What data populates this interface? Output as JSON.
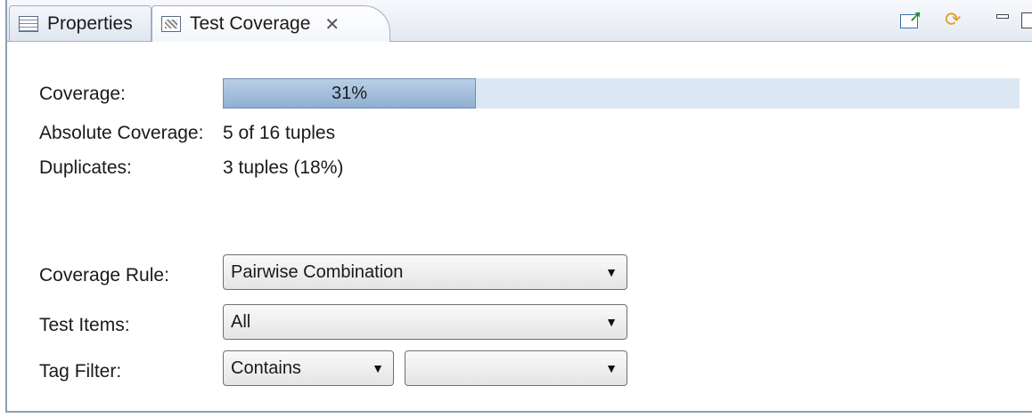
{
  "tabs": [
    {
      "label": "Properties",
      "icon": "properties-icon"
    },
    {
      "label": "Test Coverage",
      "icon": "coverage-icon",
      "active": true
    }
  ],
  "toolbar": {
    "export_icon": "export-icon",
    "refresh_icon": "refresh-icon",
    "minimize_icon": "minimize-icon",
    "maximize_icon": "maximize-icon"
  },
  "coverage": {
    "label": "Coverage:",
    "percent_text": "31%",
    "fraction": 0.31
  },
  "absolute": {
    "label": "Absolute Coverage:",
    "value": "5 of 16 tuples"
  },
  "duplicates": {
    "label": "Duplicates:",
    "value": "3 tuples (18%)"
  },
  "coverage_rule": {
    "label": "Coverage Rule:",
    "value": "Pairwise Combination"
  },
  "test_items": {
    "label": "Test Items:",
    "value": "All"
  },
  "tag_filter": {
    "label": "Tag Filter:",
    "mode": "Contains",
    "value": ""
  },
  "colors": {
    "progress_fill": "#a3bfdd",
    "progress_track": "#dbe7f3",
    "border": "#8f9fb3"
  }
}
